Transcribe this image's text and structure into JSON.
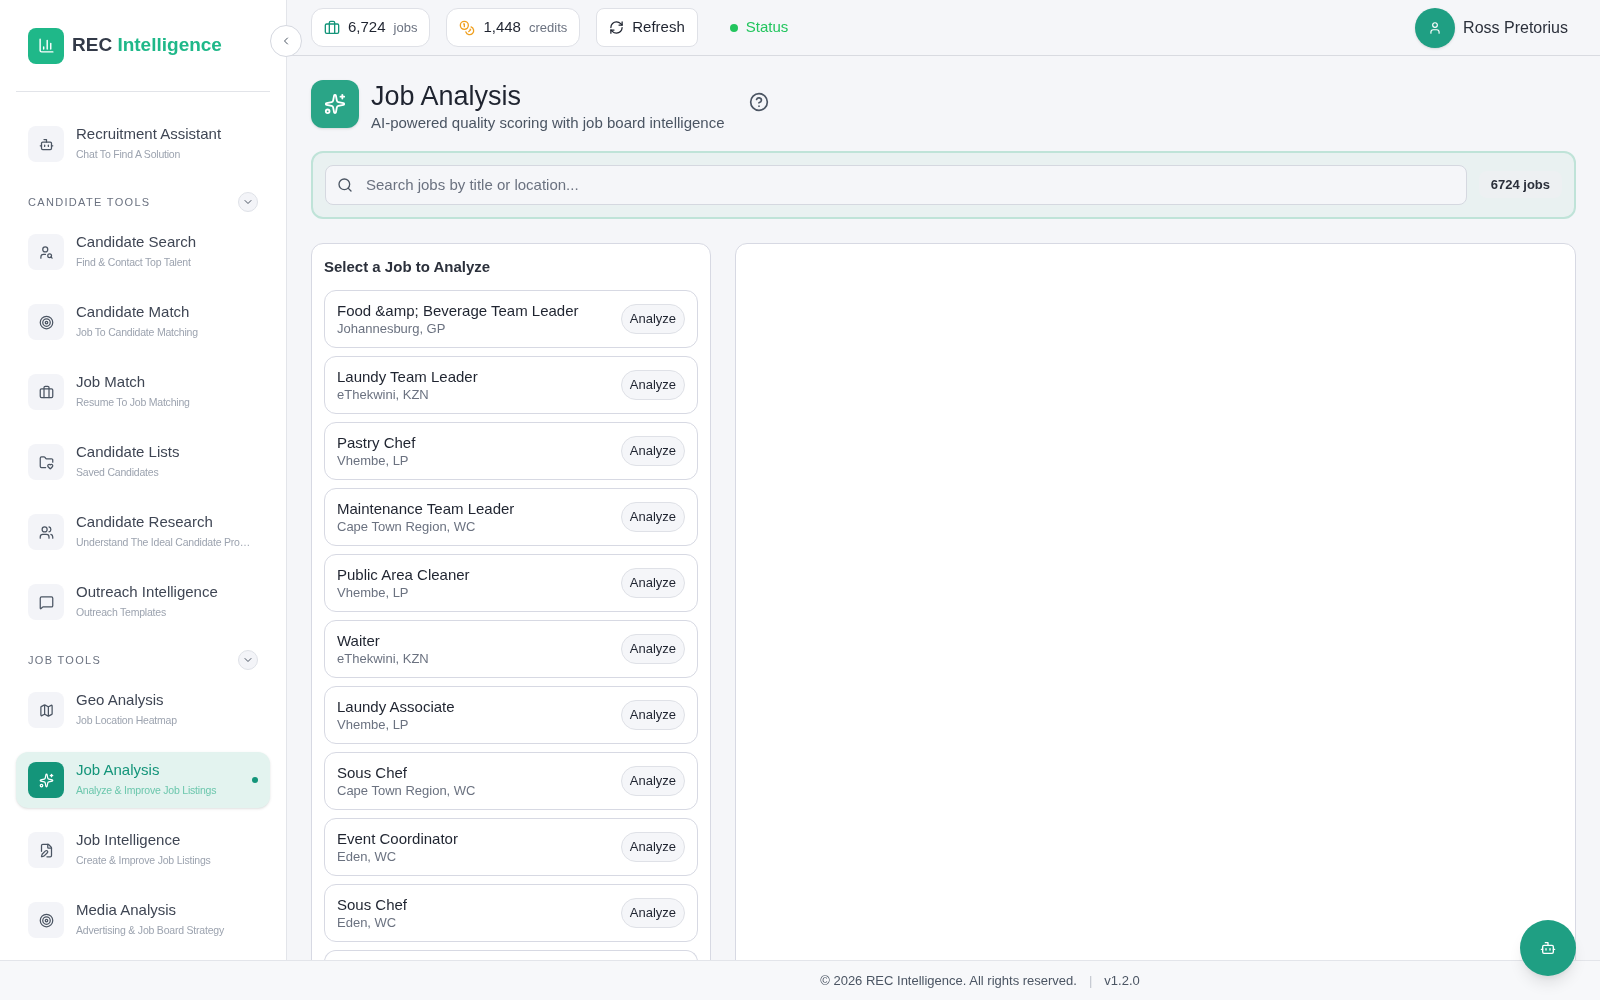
{
  "brand": {
    "first": "REC",
    "second": "Intelligence"
  },
  "sidebar": {
    "collapse_button": true,
    "top_item": {
      "title": "Recruitment Assistant",
      "subtitle": "Chat To Find A Solution",
      "selected": false
    },
    "sections": [
      {
        "title": "CANDIDATE TOOLS",
        "expanded": true,
        "items": [
          {
            "title": "Candidate Search",
            "subtitle": "Find & Contact Top Talent",
            "selected": false
          },
          {
            "title": "Candidate Match",
            "subtitle": "Job To Candidate Matching",
            "selected": false
          },
          {
            "title": "Job Match",
            "subtitle": "Resume To Job Matching",
            "selected": false
          },
          {
            "title": "Candidate Lists",
            "subtitle": "Saved Candidates",
            "selected": false
          },
          {
            "title": "Candidate Research",
            "subtitle": "Understand The Ideal Candidate Pro…",
            "selected": false
          },
          {
            "title": "Outreach Intelligence",
            "subtitle": "Outreach Templates",
            "selected": false
          }
        ]
      },
      {
        "title": "JOB TOOLS",
        "expanded": true,
        "items": [
          {
            "title": "Geo Analysis",
            "subtitle": "Job Location Heatmap",
            "selected": false
          },
          {
            "title": "Job Analysis",
            "subtitle": "Analyze & Improve Job Listings",
            "selected": true
          },
          {
            "title": "Job Intelligence",
            "subtitle": "Create & Improve Job Listings",
            "selected": false
          },
          {
            "title": "Media Analysis",
            "subtitle": "Advertising & Job Board Strategy",
            "selected": false
          }
        ]
      }
    ]
  },
  "header": {
    "jobs_count": "6,724",
    "jobs_unit": "jobs",
    "credits_count": "1,448",
    "credits_unit": "credits",
    "refresh": "Refresh",
    "status": "Status",
    "user": "Ross Pretorius"
  },
  "page": {
    "title": "Job Analysis",
    "subtitle": "AI-powered quality scoring with job board intelligence"
  },
  "search": {
    "placeholder": "Search jobs by title or location...",
    "count": "6724 jobs"
  },
  "job_list": {
    "title": "Select a Job to Analyze",
    "jobs": [
      {
        "title": "Food &amp; Beverage Team Leader",
        "location": "Johannesburg, GP",
        "button": "Analyze"
      },
      {
        "title": "Laundy Team Leader",
        "location": "eThekwini, KZN",
        "button": "Analyze"
      },
      {
        "title": "Pastry Chef",
        "location": "Vhembe, LP",
        "button": "Analyze"
      },
      {
        "title": "Maintenance Team Leader",
        "location": "Cape Town Region, WC",
        "button": "Analyze"
      },
      {
        "title": "Public Area Cleaner",
        "location": "Vhembe, LP",
        "button": "Analyze"
      },
      {
        "title": "Waiter",
        "location": "eThekwini, KZN",
        "button": "Analyze"
      },
      {
        "title": "Laundy Associate",
        "location": "Vhembe, LP",
        "button": "Analyze"
      },
      {
        "title": "Sous Chef",
        "location": "Cape Town Region, WC",
        "button": "Analyze"
      },
      {
        "title": "Event Coordinator",
        "location": "Eden, WC",
        "button": "Analyze"
      },
      {
        "title": "Sous Chef",
        "location": "Eden, WC",
        "button": "Analyze"
      }
    ]
  },
  "footer": {
    "copyright": "© 2026 REC Intelligence. All rights reserved.",
    "separator": "|",
    "version": "v1.2.0"
  }
}
